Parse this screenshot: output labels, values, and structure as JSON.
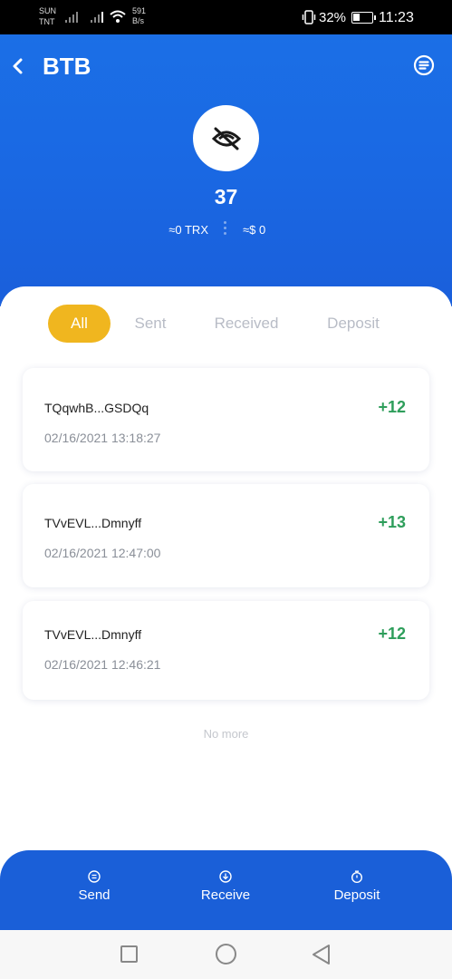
{
  "status_bar": {
    "carrier_line1": "SUN",
    "carrier_line2": "TNT",
    "net_speed_value": "591",
    "net_speed_unit": "B/s",
    "battery_percent": "32%",
    "time": "11:23"
  },
  "header": {
    "title": "BTB",
    "back_icon": "chevron-left-icon",
    "menu_icon": "list-circle-icon",
    "token_logo_icon": "hidden-eye-slash-icon",
    "balance": "37",
    "trx_value": "≈0 TRX",
    "usd_value": "≈$ 0"
  },
  "tabs": [
    {
      "label": "All",
      "active": true
    },
    {
      "label": "Sent",
      "active": false
    },
    {
      "label": "Received",
      "active": false
    },
    {
      "label": "Deposit",
      "active": false
    }
  ],
  "transactions": [
    {
      "address": "TQqwhB...GSDQq",
      "datetime": "02/16/2021 13:18:27",
      "amount": "+12"
    },
    {
      "address": "TVvEVL...Dmnyff",
      "datetime": "02/16/2021 12:47:00",
      "amount": "+13"
    },
    {
      "address": "TVvEVL...Dmnyff",
      "datetime": "02/16/2021 12:46:21",
      "amount": "+12"
    }
  ],
  "list_footer": "No more",
  "actions": {
    "send_label": "Send",
    "receive_label": "Receive",
    "deposit_label": "Deposit"
  },
  "colors": {
    "header_blue": "#1a68e3",
    "active_tab": "#f0b61f",
    "positive_amount": "#2e9e5b",
    "action_bar": "#1a5fd8"
  }
}
